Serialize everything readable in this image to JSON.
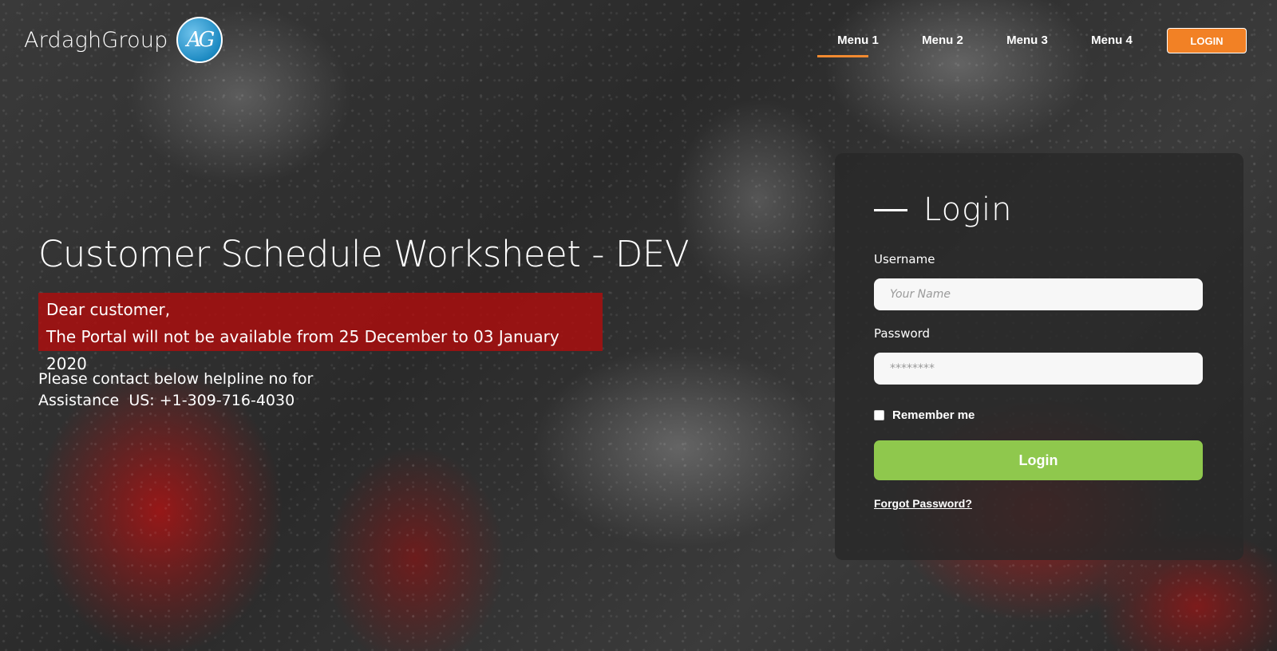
{
  "header": {
    "logo_text": "ArdaghGroup",
    "logo_mark": "AG",
    "nav": [
      {
        "label": "Menu 1",
        "active": true
      },
      {
        "label": "Menu 2",
        "active": false
      },
      {
        "label": "Menu 3",
        "active": false
      },
      {
        "label": "Menu 4",
        "active": false
      }
    ],
    "login_button": "LOGIN"
  },
  "hero": {
    "title": "Customer Schedule Worksheet - DEV",
    "notice_line1": "Dear customer,",
    "notice_line2": "The Portal will not be available from 25 December to 03 January 2020",
    "helpline_line1": "Please contact below helpline no for",
    "helpline_line2": "Assistance  US: +1-309-716-4030"
  },
  "login_panel": {
    "title": "Login",
    "username_label": "Username",
    "username_placeholder": "Your Name",
    "password_label": "Password",
    "password_placeholder": "********",
    "remember_label": "Remember me",
    "submit_label": "Login",
    "forgot_label": "Forgot Password?"
  },
  "colors": {
    "accent_orange": "#f28125",
    "login_green": "#8fc84d",
    "notice_red": "#af0e0e",
    "logo_blue": "#1e8bc3"
  },
  "icons": {
    "logo": "ardagh-group-logo-icon",
    "heading_dash": "dash-icon"
  }
}
